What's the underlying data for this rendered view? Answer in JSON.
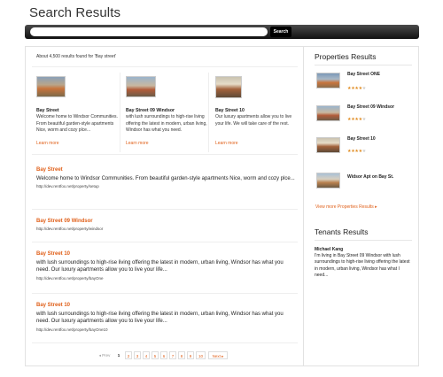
{
  "page": {
    "title": "Search Results"
  },
  "search": {
    "placeholder": "",
    "button_label": "Search"
  },
  "results_count": "About 4,500 results found for 'Bay street'",
  "featured": [
    {
      "title": "Bay Street",
      "desc": "Welcome home to Windsor Communities. From beautiful garden-style apartments Nice, worm and cozy plce...",
      "more": "Learn more"
    },
    {
      "title": "Bay Street 09 Windsor",
      "desc": "with lush surroundings to high-rise living offering the latest in modern, urban living, Windsor has what you need.",
      "more": "Learn more"
    },
    {
      "title": "Bay Street 10",
      "desc": "Our luxury apartments allow you to live your life. We will take care of the rest.",
      "more": "Learn more"
    }
  ],
  "results": [
    {
      "title": "Bay Street",
      "desc": "Welcome home to Windsor Communities. From beautiful garden-style apartments Nice, worm and cozy plce...",
      "url": "http://dev.rentfox.net/property/setup"
    },
    {
      "title": "Bay Street 09 Windsor",
      "desc": "",
      "url": "http://dev.rentfox.net/property/windsor"
    },
    {
      "title": "Bay Street 10",
      "desc": "with lush surroundings to high-rise living offering the latest in modern, urban living, Windsor has what you need. Our luxury apartments allow you to live your life...",
      "url": "http://dev.rentfox.net/property/bayOne"
    },
    {
      "title": "Bay Street 10",
      "desc": "with lush surroundings to high-rise living offering the latest in modern, urban living, Windsor has what you need. Our luxury apartments allow you to live your life...",
      "url": "http://dev.rentfox.net/property/bayOne10"
    }
  ],
  "pagination": {
    "prev": "◂ Prev",
    "current": "1",
    "pages": [
      "2",
      "3",
      "4",
      "5",
      "6",
      "7",
      "8",
      "9",
      "10"
    ],
    "next": "Next ▸"
  },
  "sidebar": {
    "properties_title": "Properties Results",
    "properties": [
      {
        "name": "Bay Street ONE",
        "rating": 4
      },
      {
        "name": "Bay Street 09 Windsor",
        "rating": 4
      },
      {
        "name": "Bay Street 10",
        "rating": 4
      },
      {
        "name": "Widsor Apt on Bay St.",
        "rating": 0
      }
    ],
    "view_more": "View more Properties Results  ▸",
    "tenants_title": "Tenants Results",
    "tenant": {
      "name": "Michael Kang",
      "text": "I'm living in Bay Street 09 Windsor with lush surroundings to high-rise living offering the latest in modern, urban living, Windsor has what I need..."
    }
  },
  "colors": {
    "accent": "#e0601a",
    "star": "#e08a1e",
    "searchbar": "#1a1a1a"
  },
  "icons": {
    "star": "star-icon",
    "prev": "chevron-left-icon",
    "next": "chevron-right-icon"
  }
}
